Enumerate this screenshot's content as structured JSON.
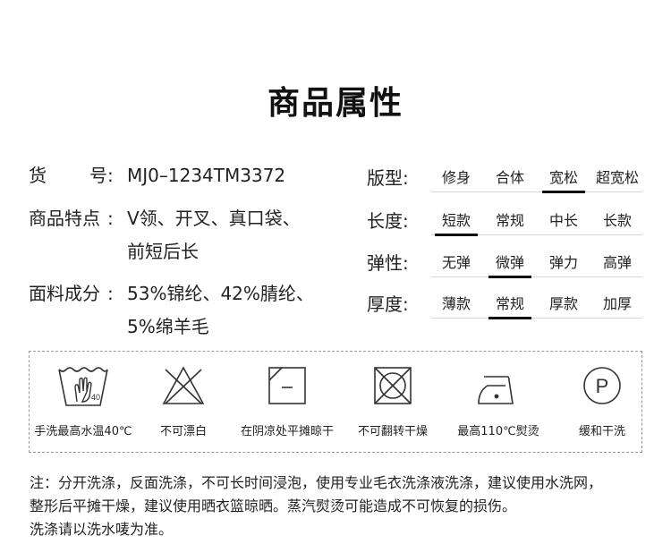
{
  "title": "商品属性",
  "specs": {
    "code_label_a": "货",
    "code_label_b": "号",
    "colon": ":",
    "code_value": "MJ0–1234TM3372",
    "features_label": "商品特点",
    "features_line1": "V领、开叉、真口袋、",
    "features_line2": "前短后长",
    "material_label": "面料成分",
    "material_line1": "53%锦纶、42%腈纶、",
    "material_line2": "5%绵羊毛"
  },
  "attributes": [
    {
      "label": "版型:",
      "options": [
        "修身",
        "合体",
        "宽松",
        "超宽松"
      ],
      "selected_index": 2
    },
    {
      "label": "长度:",
      "options": [
        "短款",
        "常规",
        "中长",
        "长款"
      ],
      "selected_index": 0
    },
    {
      "label": "弹性:",
      "options": [
        "无弹",
        "微弹",
        "弹力",
        "高弹"
      ],
      "selected_index": 1
    },
    {
      "label": "厚度:",
      "options": [
        "薄款",
        "常规",
        "厚款",
        "加厚"
      ],
      "selected_index": 1
    }
  ],
  "care": [
    {
      "icon": "hand-wash-icon",
      "label": "手洗最高水温40℃"
    },
    {
      "icon": "no-bleach-icon",
      "label": "不可漂白"
    },
    {
      "icon": "shade-flat-dry-icon",
      "label": "在阴凉处平摊晾干"
    },
    {
      "icon": "no-tumble-dry-icon",
      "label": "不可翻转干燥"
    },
    {
      "icon": "iron-110-icon",
      "label": "最高110℃熨烫"
    },
    {
      "icon": "dry-clean-p-icon",
      "label": "缓和干洗"
    }
  ],
  "care_icon_texts": {
    "hand_wash_temp": "40",
    "dry_clean_letter": "P"
  },
  "notes": {
    "line1": "注：分开洗涤，反面洗涤，不可长时间浸泡，使用专业毛衣洗涤液洗涤，建议使用水洗网，",
    "line2": "整形后平摊干燥，建议使用晒衣篮晾晒。蒸汽熨烫可能造成不可恢复的损伤。",
    "line3": "洗涤请以洗水唛为准。"
  }
}
